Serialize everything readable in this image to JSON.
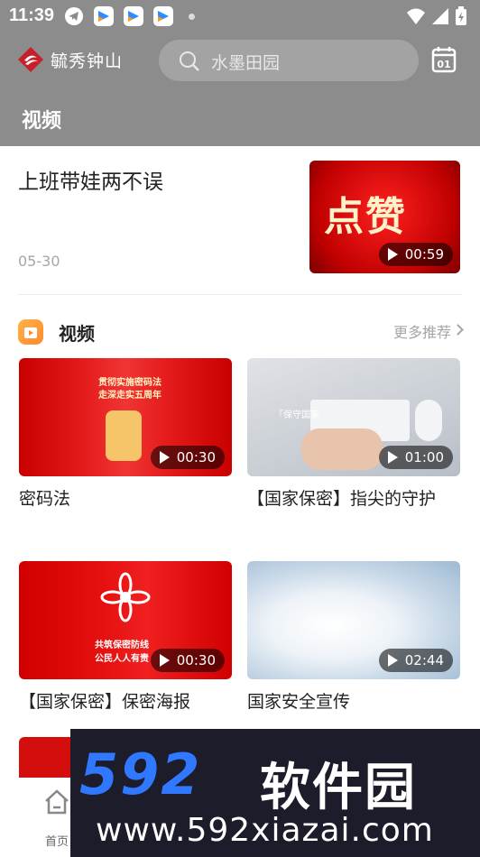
{
  "status_bar": {
    "time": "11:39"
  },
  "header": {
    "logo_text": "毓秀钟山",
    "search_placeholder": "水墨田园"
  },
  "page_title": "视频",
  "top_item": {
    "title": "上班带娃两不误",
    "date": "05-30",
    "duration": "00:59",
    "thumb_text": "点赞"
  },
  "section": {
    "name": "视频",
    "more": "更多推荐"
  },
  "cards": [
    {
      "title": "密码法",
      "duration": "00:30",
      "thumb_text_1": "贯彻实施密码法",
      "thumb_text_2": "走深走实五周年"
    },
    {
      "title": "【国家保密】指尖的守护",
      "duration": "01:00",
      "thumb_text_1": "「保守国家"
    },
    {
      "title": "【国家保密】保密海报",
      "duration": "00:30",
      "thumb_text_1": "共筑保密防线",
      "thumb_text_2": "公民人人有责"
    },
    {
      "title": "国家安全宣传",
      "duration": "02:44"
    }
  ],
  "tabbar": {
    "home_label": "首页"
  },
  "watermark": {
    "brand_digits": "592",
    "brand_cn": "软件园",
    "url": "www.592xiazai.com"
  },
  "colors": {
    "header_bg": "#8c8c8c",
    "accent_red": "#e01010",
    "watermark_blue": "#2f78ff"
  }
}
